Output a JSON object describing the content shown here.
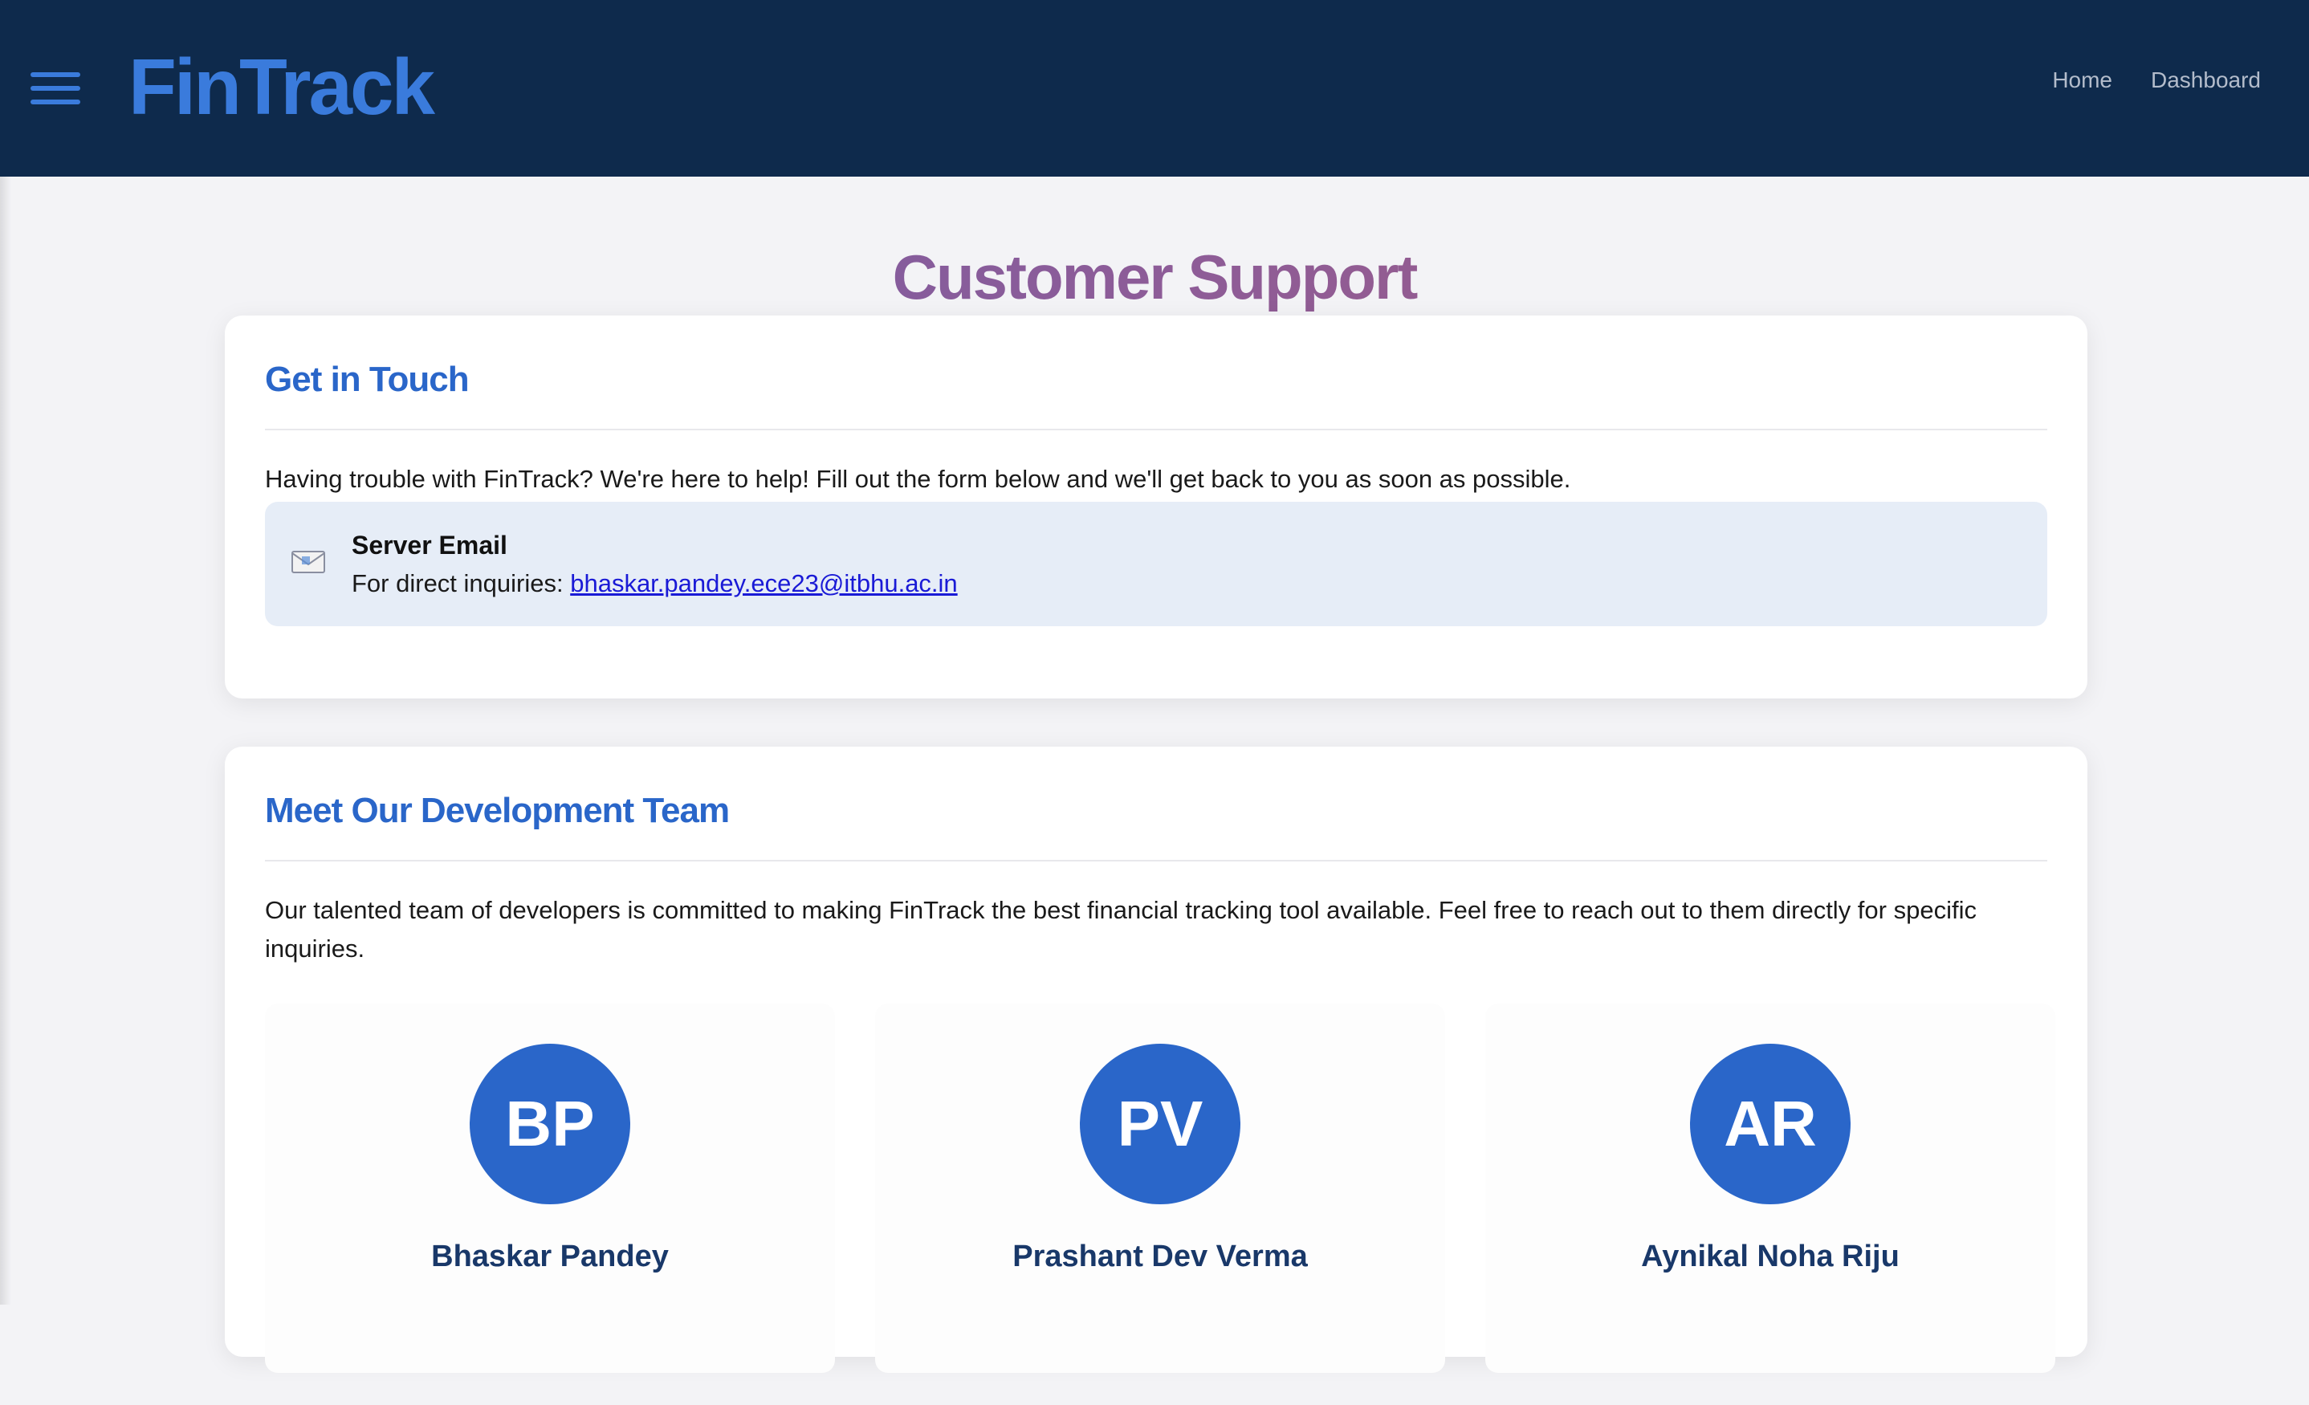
{
  "nav": {
    "brand": "FinTrack",
    "links": [
      "Home",
      "Dashboard"
    ]
  },
  "page": {
    "title": "Customer Support"
  },
  "touch": {
    "heading": "Get in Touch",
    "description": "Having trouble with FinTrack? We're here to help! Fill out the form below and we'll get back to you as soon as possible.",
    "email_box": {
      "icon": "envelope-icon",
      "title": "Server Email",
      "prefix": "For direct inquiries: ",
      "email": "bhaskar.pandey.ece23@itbhu.ac.in"
    }
  },
  "team": {
    "heading": "Meet Our Development Team",
    "description": "Our talented team of developers is committed to making FinTrack the best financial tracking tool available. Feel free to reach out to them directly for specific inquiries.",
    "members": [
      {
        "initials": "BP",
        "name": "Bhaskar Pandey"
      },
      {
        "initials": "PV",
        "name": "Prashant Dev Verma"
      },
      {
        "initials": "AR",
        "name": "Aynikal Noha Riju"
      }
    ]
  },
  "colors": {
    "navbar": "#0e2a4c",
    "accent": "#2a66c9",
    "brand": "#3a7bdc"
  }
}
